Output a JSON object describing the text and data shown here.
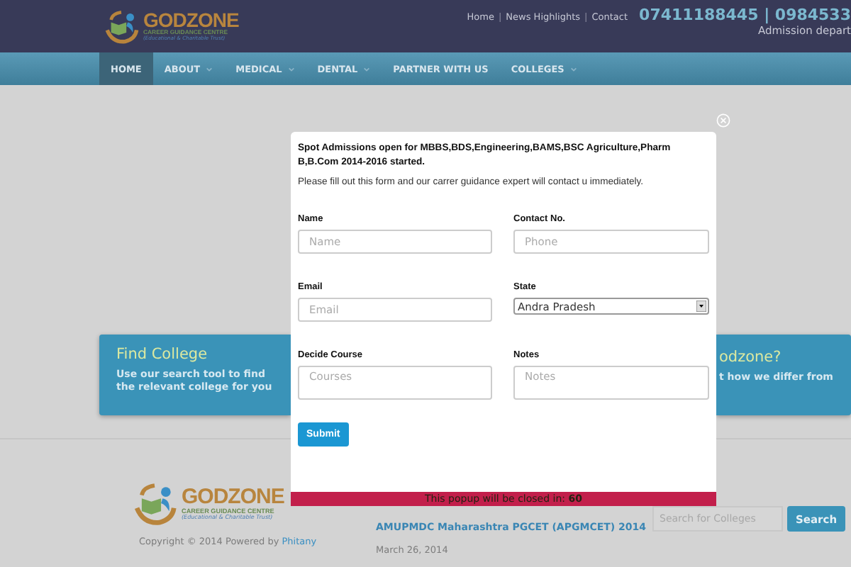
{
  "header": {
    "logo": {
      "name": "GODZONE",
      "subtitle": "CAREER GUIDANCE CENTRE",
      "trust": "(Educational & Charitable Trust)"
    },
    "links": [
      "Home",
      "News Highlights",
      "Contact"
    ],
    "link_separators": [
      "|",
      "|"
    ],
    "phone": "07411188445 | 0984533",
    "phone_note": "Admission depart"
  },
  "nav": [
    {
      "label": "HOME",
      "selected": true,
      "has_menu": false
    },
    {
      "label": "ABOUT",
      "selected": false,
      "has_menu": true
    },
    {
      "label": "MEDICAL",
      "selected": false,
      "has_menu": true
    },
    {
      "label": "DENTAL",
      "selected": false,
      "has_menu": true
    },
    {
      "label": "PARTNER WITH US",
      "selected": false,
      "has_menu": false
    },
    {
      "label": "COLLEGES",
      "selected": false,
      "has_menu": true
    }
  ],
  "cards": [
    {
      "title": "Find College",
      "text": "Use our search tool to find the relevant college for you"
    },
    {
      "title": "odzone?",
      "text": "t how we differ from"
    }
  ],
  "popup": {
    "notice": "Spot Admissions open for MBBS,BDS,Engineering,BAMS,BSC Agriculture,Pharm B,B.Com 2014-2016 started.",
    "intro": "Please fill out this form and our carrer guidance expert will contact u immediately.",
    "fields": [
      {
        "label": "Name",
        "kind": "input",
        "placeholder": "Name"
      },
      {
        "label": "Contact No.",
        "kind": "input",
        "placeholder": "Phone"
      },
      {
        "label": "Email",
        "kind": "input",
        "placeholder": "Email"
      },
      {
        "label": "State",
        "kind": "select",
        "value": "Andra Pradesh"
      },
      {
        "label": "Decide Course",
        "kind": "textarea",
        "placeholder": "Courses"
      },
      {
        "label": "Notes",
        "kind": "textarea",
        "placeholder": "Notes"
      }
    ],
    "submit": "Submit",
    "countdown": "This popup will be closed in: **60**"
  },
  "footer": {
    "logo": {
      "name": "GODZONE",
      "subtitle": "CAREER GUIDANCE CENTRE",
      "trust": "(Educational & Charitable Trust)"
    },
    "copyright": "Copyright © 2014 Powered by",
    "copyright_link": "Phitany",
    "post": {
      "title": "AMUPMDC Maharashtra PGCET (APGMCET) 2014",
      "date": "March 26, 2014"
    },
    "search": {
      "placeholder": "Search for Colleges",
      "button": "Search"
    }
  }
}
